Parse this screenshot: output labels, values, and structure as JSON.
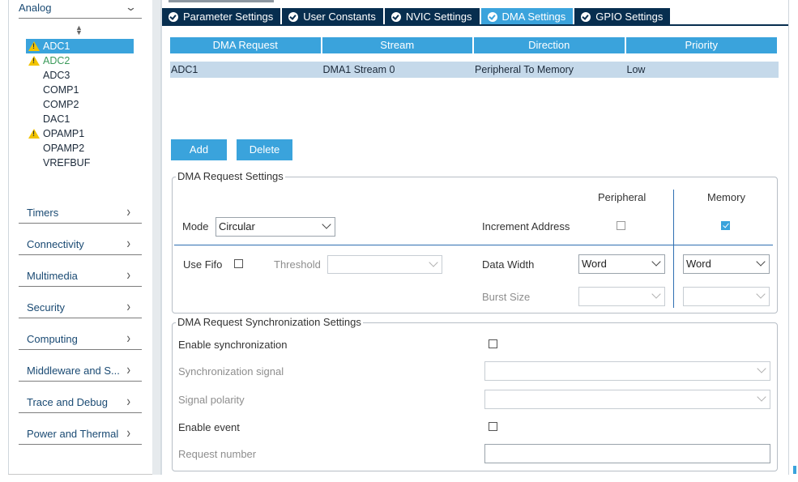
{
  "sidebar": {
    "analog": {
      "title": "Analog",
      "items": [
        {
          "label": "ADC1",
          "warning": true,
          "selected": true
        },
        {
          "label": "ADC2",
          "warning": true,
          "status_color": "#3b9a5a"
        },
        {
          "label": "ADC3"
        },
        {
          "label": "COMP1"
        },
        {
          "label": "COMP2"
        },
        {
          "label": "DAC1"
        },
        {
          "label": "OPAMP1",
          "warning": true
        },
        {
          "label": "OPAMP2"
        },
        {
          "label": "VREFBUF"
        }
      ]
    },
    "categories": [
      {
        "label": "Timers"
      },
      {
        "label": "Connectivity"
      },
      {
        "label": "Multimedia"
      },
      {
        "label": "Security"
      },
      {
        "label": "Computing"
      },
      {
        "label": "Middleware and S..."
      },
      {
        "label": "Trace and Debug"
      },
      {
        "label": "Power and Thermal"
      }
    ]
  },
  "tabs": [
    {
      "label": "Parameter Settings",
      "active": false
    },
    {
      "label": "User Constants",
      "active": false
    },
    {
      "label": "NVIC Settings",
      "active": false
    },
    {
      "label": "DMA Settings",
      "active": true
    },
    {
      "label": "GPIO Settings",
      "active": false
    }
  ],
  "dma_table": {
    "columns": [
      "DMA Request",
      "Stream",
      "Direction",
      "Priority"
    ],
    "rows": [
      [
        "ADC1",
        "DMA1 Stream 0",
        "Peripheral To Memory",
        "Low"
      ]
    ]
  },
  "buttons": {
    "add": "Add",
    "delete": "Delete"
  },
  "request_settings": {
    "legend": "DMA Request Settings",
    "peripheral_header": "Peripheral",
    "memory_header": "Memory",
    "mode_label": "Mode",
    "mode_value": "Circular",
    "increment_address_label": "Increment Address",
    "peripheral_increment_checked": false,
    "memory_increment_checked": true,
    "use_fifo_label": "Use Fifo",
    "use_fifo_checked": false,
    "threshold_label": "Threshold",
    "threshold_value": "",
    "data_width_label": "Data Width",
    "peripheral_data_width": "Word",
    "memory_data_width": "Word",
    "burst_size_label": "Burst Size",
    "peripheral_burst_size": "",
    "memory_burst_size": ""
  },
  "sync_settings": {
    "legend": "DMA Request Synchronization Settings",
    "enable_sync_label": "Enable synchronization",
    "enable_sync_checked": false,
    "sync_signal_label": "Synchronization signal",
    "sync_signal_value": "",
    "signal_polarity_label": "Signal polarity",
    "signal_polarity_value": "",
    "enable_event_label": "Enable event",
    "enable_event_checked": false,
    "request_number_label": "Request number",
    "request_number_value": ""
  },
  "colors": {
    "accent": "#3aa3dc",
    "tab_dark": "#072e4f",
    "row_selected": "#c5d9ea",
    "warning": "#f2c400"
  }
}
